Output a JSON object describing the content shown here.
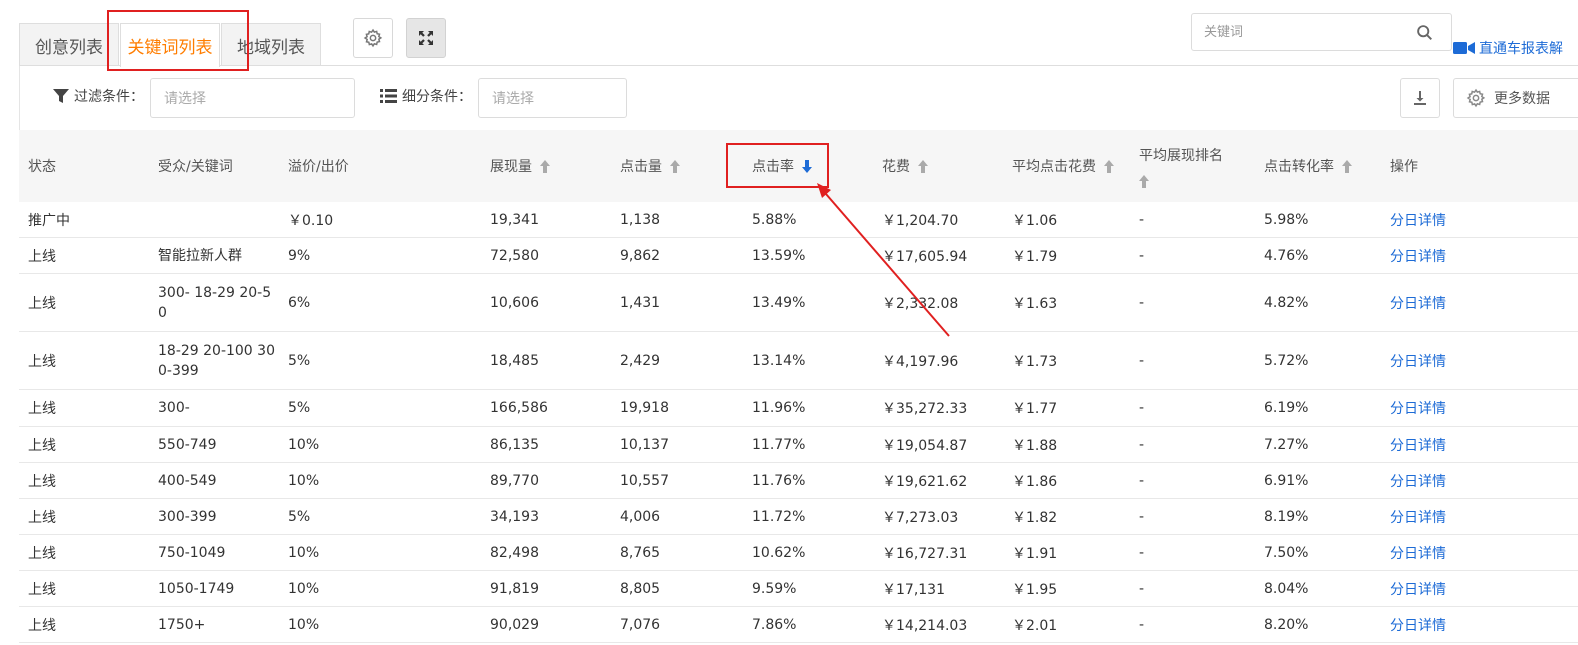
{
  "tabs": [
    {
      "label": "创意列表",
      "active": false
    },
    {
      "label": "关键词列表",
      "active": true
    },
    {
      "label": "地域列表",
      "active": false
    }
  ],
  "search": {
    "placeholder": "关键词"
  },
  "explain_link": "直通车报表解",
  "filter": {
    "filter_label": "过滤条件：",
    "filter_placeholder": "请选择",
    "segment_label": "细分条件：",
    "segment_placeholder": "请选择",
    "more_data_label": "更多数据"
  },
  "table": {
    "headers": {
      "status": "状态",
      "audience": "受众/关键词",
      "premium": "溢价/出价",
      "impressions": "展现量",
      "clicks": "点击量",
      "ctr": "点击率",
      "cost": "花费",
      "cpc": "平均点击花费",
      "avg_rank": "平均展现排名",
      "cvr": "点击转化率",
      "ops": "操作"
    },
    "sort": {
      "column": "ctr",
      "direction": "desc"
    },
    "rows": [
      {
        "status": "推广中",
        "audience": "",
        "premium": "￥0.10",
        "impressions": "19,341",
        "clicks": "1,138",
        "ctr": "5.88%",
        "cost": "￥1,204.70",
        "cpc": "￥1.06",
        "avg_rank": "-",
        "cvr": "5.98%",
        "op": "分日详情"
      },
      {
        "status": "上线",
        "audience": "智能拉新人群",
        "premium": "9%",
        "impressions": "72,580",
        "clicks": "9,862",
        "ctr": "13.59%",
        "cost": "￥17,605.94",
        "cpc": "￥1.79",
        "avg_rank": "-",
        "cvr": "4.76%",
        "op": "分日详情"
      },
      {
        "status": "上线",
        "audience": "300- 18-29 20-50",
        "premium": "6%",
        "impressions": "10,606",
        "clicks": "1,431",
        "ctr": "13.49%",
        "cost": "￥2,332.08",
        "cpc": "￥1.63",
        "avg_rank": "-",
        "cvr": "4.82%",
        "op": "分日详情"
      },
      {
        "status": "上线",
        "audience": "18-29 20-100 300-399",
        "premium": "5%",
        "impressions": "18,485",
        "clicks": "2,429",
        "ctr": "13.14%",
        "cost": "￥4,197.96",
        "cpc": "￥1.73",
        "avg_rank": "-",
        "cvr": "5.72%",
        "op": "分日详情"
      },
      {
        "status": "上线",
        "audience": "300-",
        "premium": "5%",
        "impressions": "166,586",
        "clicks": "19,918",
        "ctr": "11.96%",
        "cost": "￥35,272.33",
        "cpc": "￥1.77",
        "avg_rank": "-",
        "cvr": "6.19%",
        "op": "分日详情"
      },
      {
        "status": "上线",
        "audience": "550-749",
        "premium": "10%",
        "impressions": "86,135",
        "clicks": "10,137",
        "ctr": "11.77%",
        "cost": "￥19,054.87",
        "cpc": "￥1.88",
        "avg_rank": "-",
        "cvr": "7.27%",
        "op": "分日详情"
      },
      {
        "status": "上线",
        "audience": "400-549",
        "premium": "10%",
        "impressions": "89,770",
        "clicks": "10,557",
        "ctr": "11.76%",
        "cost": "￥19,621.62",
        "cpc": "￥1.86",
        "avg_rank": "-",
        "cvr": "6.91%",
        "op": "分日详情"
      },
      {
        "status": "上线",
        "audience": "300-399",
        "premium": "5%",
        "impressions": "34,193",
        "clicks": "4,006",
        "ctr": "11.72%",
        "cost": "￥7,273.03",
        "cpc": "￥1.82",
        "avg_rank": "-",
        "cvr": "8.19%",
        "op": "分日详情"
      },
      {
        "status": "上线",
        "audience": "750-1049",
        "premium": "10%",
        "impressions": "82,498",
        "clicks": "8,765",
        "ctr": "10.62%",
        "cost": "￥16,727.31",
        "cpc": "￥1.91",
        "avg_rank": "-",
        "cvr": "7.50%",
        "op": "分日详情"
      },
      {
        "status": "上线",
        "audience": "1050-1749",
        "premium": "10%",
        "impressions": "91,819",
        "clicks": "8,805",
        "ctr": "9.59%",
        "cost": "￥17,131",
        "cpc": "￥1.95",
        "avg_rank": "-",
        "cvr": "8.04%",
        "op": "分日详情"
      },
      {
        "status": "上线",
        "audience": "1750+",
        "premium": "10%",
        "impressions": "90,029",
        "clicks": "7,076",
        "ctr": "7.86%",
        "cost": "￥14,214.03",
        "cpc": "￥2.01",
        "avg_rank": "-",
        "cvr": "8.20%",
        "op": "分日详情"
      }
    ]
  },
  "colors": {
    "accent_orange": "#ff7d00",
    "link_blue": "#1d6bd6",
    "annotation_red": "#e02020"
  },
  "icons": {
    "settings": "gear-icon",
    "fullscreen": "fullscreen-icon",
    "search": "search-icon",
    "video": "video-camera-icon",
    "filter": "filter-icon",
    "segment": "list-icon",
    "download": "download-icon",
    "more_data": "gear-icon"
  }
}
